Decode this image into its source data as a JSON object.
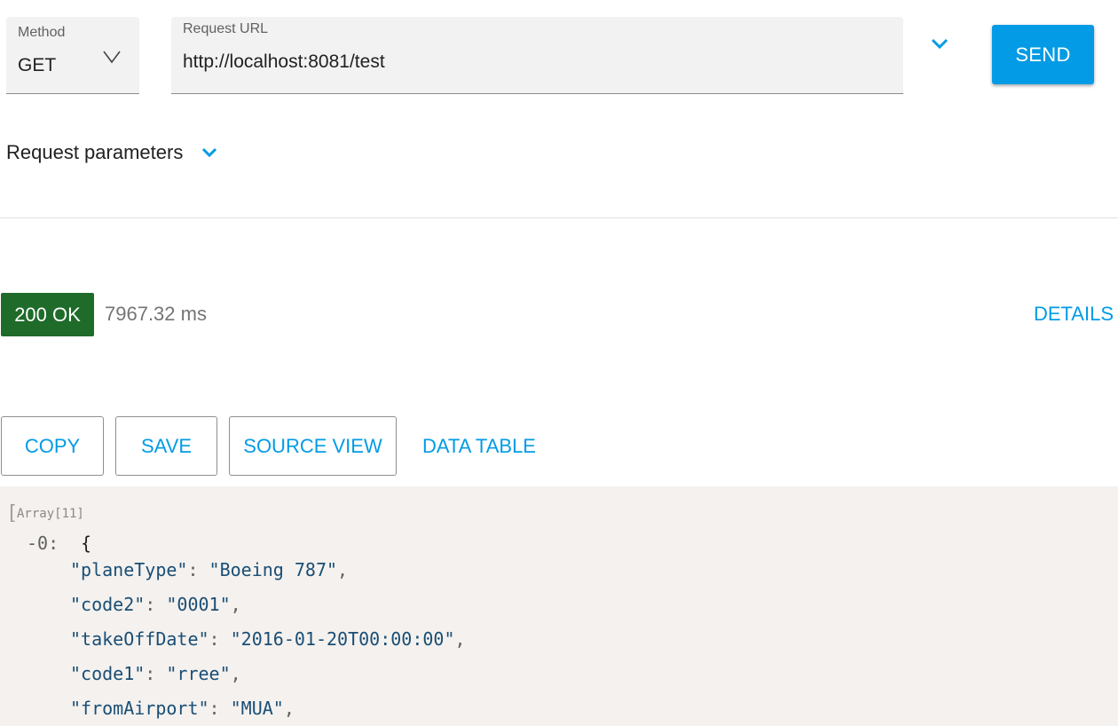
{
  "request": {
    "method_label": "Method",
    "method_value": "GET",
    "url_label": "Request URL",
    "url_value": "http://localhost:8081/test",
    "send_label": "SEND",
    "params_label": "Request parameters"
  },
  "response": {
    "status": "200 OK",
    "time": "7967.32 ms",
    "details_label": "DETAILS",
    "actions": {
      "copy": "COPY",
      "save": "SAVE",
      "source_view": "SOURCE VIEW",
      "data_table": "DATA TABLE"
    }
  },
  "body_view": {
    "array_open": "[",
    "array_type": "Array[11]",
    "item_toggle": "-0:",
    "item_open": "{",
    "fields": [
      {
        "key": "\"planeType\"",
        "value": "\"Boeing 787\""
      },
      {
        "key": "\"code2\"",
        "value": "\"0001\""
      },
      {
        "key": "\"takeOffDate\"",
        "value": "\"2016-01-20T00:00:00\""
      },
      {
        "key": "\"code1\"",
        "value": "\"rree\""
      },
      {
        "key": "\"fromAirport\"",
        "value": "\"MUA\""
      }
    ]
  },
  "colors": {
    "accent": "#039be5",
    "status_ok": "#1e6b2a",
    "code_background": "#f4f1ee"
  },
  "icons": {
    "method_dropdown": "chevron-down-icon",
    "url_options": "chevron-down-icon",
    "params_toggle": "chevron-down-icon"
  }
}
